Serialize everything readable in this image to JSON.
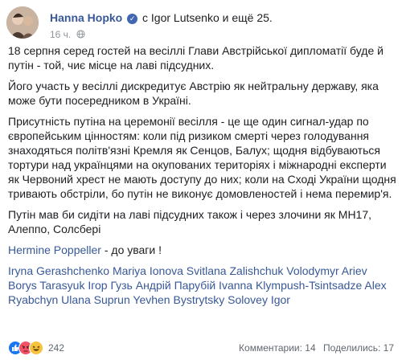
{
  "post": {
    "author": "Hanna Hopko",
    "with_prefix": "с",
    "tagged_person": "Igor Lutsenko",
    "and_more": "и ещё 25.",
    "time": "16 ч.",
    "paragraphs": [
      "18 серпня серед гостей на весіллі Глави Австрійської дипломатії буде й путін - той, чиє місце на лаві підсудних.",
      "Його участь у весіллі дискредитує Австрію як нейтральну державу, яка може бути посередником в Україні.",
      "Присутність путіна на церемонії весілля - це ще один сигнал-удар по європейським цінностям: коли під ризиком смерті через голодування знаходяться політв'язні Кремля як Сенцов, Балух; щодня відбуваються тортури над українцями на окупованих територіях і міжнародні експерти як Червоний хрест не мають доступу до них; коли на Сході України щодня тривають обстріли, бо путін не виконує домовленостей і нема перемир'я.",
      "Путін мав би сидіти на лаві підсудних також і через злочини як МН17, Алеппо, Солсбері"
    ],
    "mention_link": "Hermine Poppeller",
    "mention_suffix": " - до уваги !",
    "tags_line": "Iryna Gerashchenko Mariya Ionova Svitlana Zalishchuk Volodymyr Ariev Borys Tarasyuk Ігор Гузь Андрій Парубій Ivanna Klympush-Tsintsadze Alex Ryabchyn Ulana Suprun Yevhen Bystrytsky Solovey Igor"
  },
  "footer": {
    "reactions_count": "242",
    "comments": "Комментарии: 14",
    "shares": "Поделились: 17"
  },
  "colors": {
    "link": "#385898",
    "like": "#1877f2",
    "angry": "#f25268",
    "haha": "#f7c23e"
  },
  "icons": [
    "verified-badge-icon",
    "globe-icon",
    "like-reaction-icon",
    "angry-reaction-icon",
    "haha-reaction-icon"
  ]
}
